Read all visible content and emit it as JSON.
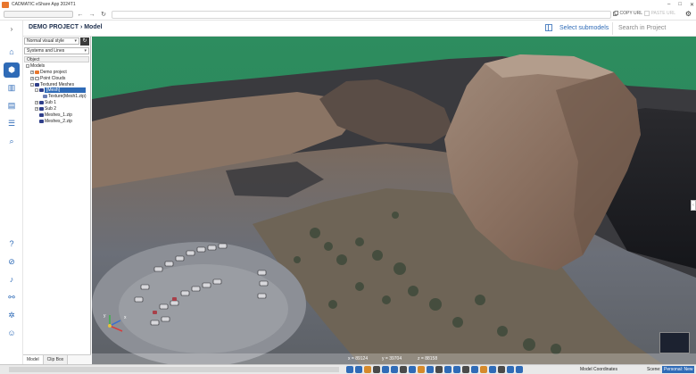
{
  "app": {
    "title": "CADMATIC eShare App 2024T1",
    "window_controls": [
      "–",
      "□",
      "✕"
    ]
  },
  "addressbar": {
    "back": "←",
    "forward": "→",
    "reload": "↻",
    "copy_url": "COPY URL",
    "paste_url": "PASTE URL"
  },
  "header": {
    "breadcrumb": "DEMO PROJECT › Model",
    "select_submodels": "Select submodels",
    "search_placeholder": "Search in Project"
  },
  "tree_panel": {
    "visual_style": "Normal visual style",
    "systems": "Systems and Lines",
    "column_header": "Object",
    "rows": [
      {
        "label": "Models",
        "level": 0,
        "expander": "-"
      },
      {
        "label": "Demo project",
        "level": 1,
        "expander": "+"
      },
      {
        "label": "Point Clouds",
        "level": 1,
        "expander": "+"
      },
      {
        "label": "Textured Meshes",
        "level": 1,
        "expander": "-"
      },
      {
        "label": "[Mesh]",
        "level": 2,
        "expander": "-",
        "selected": true
      },
      {
        "label": "Texture(Mesh1.zip)",
        "level": 3,
        "expander": ""
      },
      {
        "label": "Sub 1",
        "level": 2,
        "expander": "+"
      },
      {
        "label": "Sub 2",
        "level": 2,
        "expander": "+"
      },
      {
        "label": "Meshes_1.zip",
        "level": 2,
        "expander": ""
      },
      {
        "label": "Meshes_2.zip",
        "level": 2,
        "expander": ""
      }
    ],
    "tabs": [
      "Model",
      "Clip Box"
    ]
  },
  "status": {
    "x": "x = 89124",
    "y": "y = 39704",
    "z": "z = 88158"
  },
  "toolbar": {
    "coordinates_label": "Model Coordinates",
    "scene_label": "Scene:",
    "scene_value": "Personal: New scene"
  },
  "colors": {
    "accent": "#2f6bb7",
    "brand_orange": "#e8772e",
    "water": "#2e8a5c"
  }
}
